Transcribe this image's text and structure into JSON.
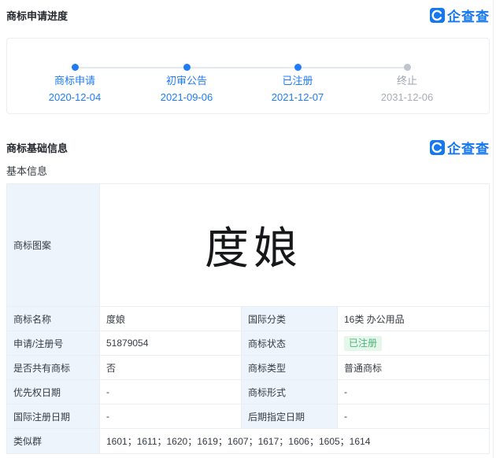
{
  "brand": {
    "name": "企查查",
    "icon": "qichacha-c-icon",
    "color": "#1678f0"
  },
  "progress": {
    "title": "商标申请进度",
    "steps": [
      {
        "label": "商标申请",
        "date": "2020-12-04",
        "state": "done"
      },
      {
        "label": "初审公告",
        "date": "2021-09-06",
        "state": "done"
      },
      {
        "label": "已注册",
        "date": "2021-12-07",
        "state": "done"
      },
      {
        "label": "终止",
        "date": "2031-12-06",
        "state": "pending"
      }
    ]
  },
  "basic": {
    "title": "商标基础信息",
    "subtitle": "基本信息",
    "image_row": {
      "label": "商标图案",
      "image_text": "度娘"
    },
    "rows": [
      {
        "c": [
          {
            "l": "商标名称",
            "v": "度娘"
          },
          {
            "l": "国际分类",
            "v": "16类 办公用品"
          }
        ]
      },
      {
        "c": [
          {
            "l": "申请/注册号",
            "v": "51879054"
          },
          {
            "l": "商标状态",
            "v": "已注册"
          }
        ]
      },
      {
        "c": [
          {
            "l": "是否共有商标",
            "v": "否"
          },
          {
            "l": "商标类型",
            "v": "普通商标"
          }
        ]
      },
      {
        "c": [
          {
            "l": "优先权日期",
            "v": "-"
          },
          {
            "l": "商标形式",
            "v": "-"
          }
        ]
      },
      {
        "c": [
          {
            "l": "国际注册日期",
            "v": "-"
          },
          {
            "l": "后期指定日期",
            "v": "-"
          }
        ]
      }
    ],
    "similar_row": {
      "label": "类似群",
      "value": "1601；1611；1620；1619；1607；1617；1606；1605；1614"
    }
  },
  "colors": {
    "accent_blue": "#1678f0",
    "timeline_done": "#1f7cf5",
    "timeline_pending": "#c0c4cc",
    "label_cell_bg": "#eef4fb",
    "table_border": "#e9edf4",
    "badge_bg": "#e5f6eb",
    "badge_text": "#4cb578"
  }
}
